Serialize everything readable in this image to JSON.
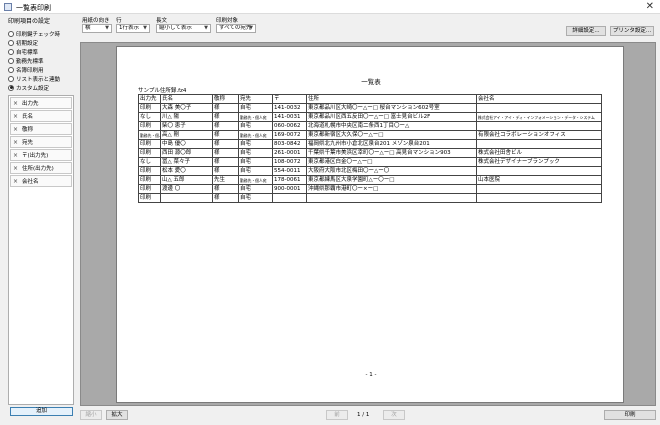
{
  "window": {
    "title": "一覧表印刷",
    "close_glyph": "✕"
  },
  "left": {
    "section_label": "印刷項目の設定",
    "radios": [
      {
        "label": "印刷鍵チェック時",
        "checked": false
      },
      {
        "label": "初期設定",
        "checked": false
      },
      {
        "label": "自宅標準",
        "checked": false
      },
      {
        "label": "勤務先標準",
        "checked": false
      },
      {
        "label": "名簿印刷用",
        "checked": false
      },
      {
        "label": "リスト表示と連動",
        "checked": false
      },
      {
        "label": "カスタム設定",
        "checked": true
      }
    ],
    "items": [
      "出力先",
      "氏名",
      "敬称",
      "宛先",
      "〒(出力先)",
      "住所(出力先)",
      "会社名"
    ],
    "add_label": "追加"
  },
  "toolbar": {
    "orientation": {
      "label": "用紙の向き",
      "value": "横"
    },
    "row": {
      "label": "行",
      "value": "1行表示"
    },
    "long_text": {
      "label": "長文",
      "value": "縮小して表示"
    },
    "target": {
      "label": "印刷対象",
      "value": "すべての宛先"
    },
    "detail_label": "詳細設定...",
    "printer_label": "プリンタ設定..."
  },
  "document": {
    "title": "一覧表",
    "subtitle": "サンプル住所録.fz4",
    "page_number": "- 1 -",
    "headers": [
      "出力先",
      "氏名",
      "敬称",
      "宛先",
      "〒",
      "住所",
      "会社名"
    ],
    "rows": [
      [
        "印刷",
        "大森 美〇子",
        "様",
        "自宅",
        "141-0032",
        "東京都品川区大崎〇ー△ー□ 桜台マンション602号室",
        ""
      ],
      [
        "なし",
        "川△ 陽",
        "様",
        "勤務先・個人宛",
        "141-0031",
        "東京都品川区西五反田〇ー△ー□ 富士見台ビル2F",
        "株式会社アイ・アイ・ディ・インフォメーション・データ・システム"
      ],
      [
        "印刷",
        "柴〇 恵子",
        "様",
        "自宅",
        "060-0062",
        "北海道札幌市中央区南二条西1丁目〇ー△",
        ""
      ],
      [
        "勤務先・個人宛",
        "高△ 剛",
        "様",
        "勤務先・個人宛",
        "169-0072",
        "東京都新宿区大久保〇ー△ー□",
        "有限会社コラボレーションオフィス"
      ],
      [
        "印刷",
        "中島 優〇",
        "様",
        "自宅",
        "803-0842",
        "福岡県北九州市小倉北区泉台201 メゾン泉台201",
        ""
      ],
      [
        "印刷",
        "西田 源〇郎",
        "様",
        "自宅",
        "261-0001",
        "千葉県千葉市美浜区幸町〇ー△ー□ 高見台マンション903",
        "株式会社田舎ビル"
      ],
      [
        "なし",
        "冨△ 菜々子",
        "様",
        "自宅",
        "108-0072",
        "東京都港区白金〇ー△ー□",
        "株式会社デザイナーブランプック"
      ],
      [
        "印刷",
        "松本 愛〇",
        "様",
        "自宅",
        "554-0011",
        "大阪府大阪市北区梅田〇ー△ー〇",
        ""
      ],
      [
        "印刷",
        "山△ 五郎",
        "先生",
        "勤務先・個人宛",
        "178-0061",
        "東京都練馬区大泉学園町△ー〇ー□",
        "山本医院"
      ],
      [
        "印刷",
        "渡邊 〇",
        "様",
        "自宅",
        "900-0001",
        "沖縄県那覇市港町〇ー×ー□",
        ""
      ],
      [
        "印刷",
        "",
        "様",
        "自宅",
        "",
        "",
        ""
      ]
    ]
  },
  "bottom": {
    "shrink_label": "縮小",
    "enlarge_label": "拡大",
    "prev_label": "前",
    "next_label": "次",
    "page_indicator": "1 / 1",
    "print_label": "印刷"
  }
}
